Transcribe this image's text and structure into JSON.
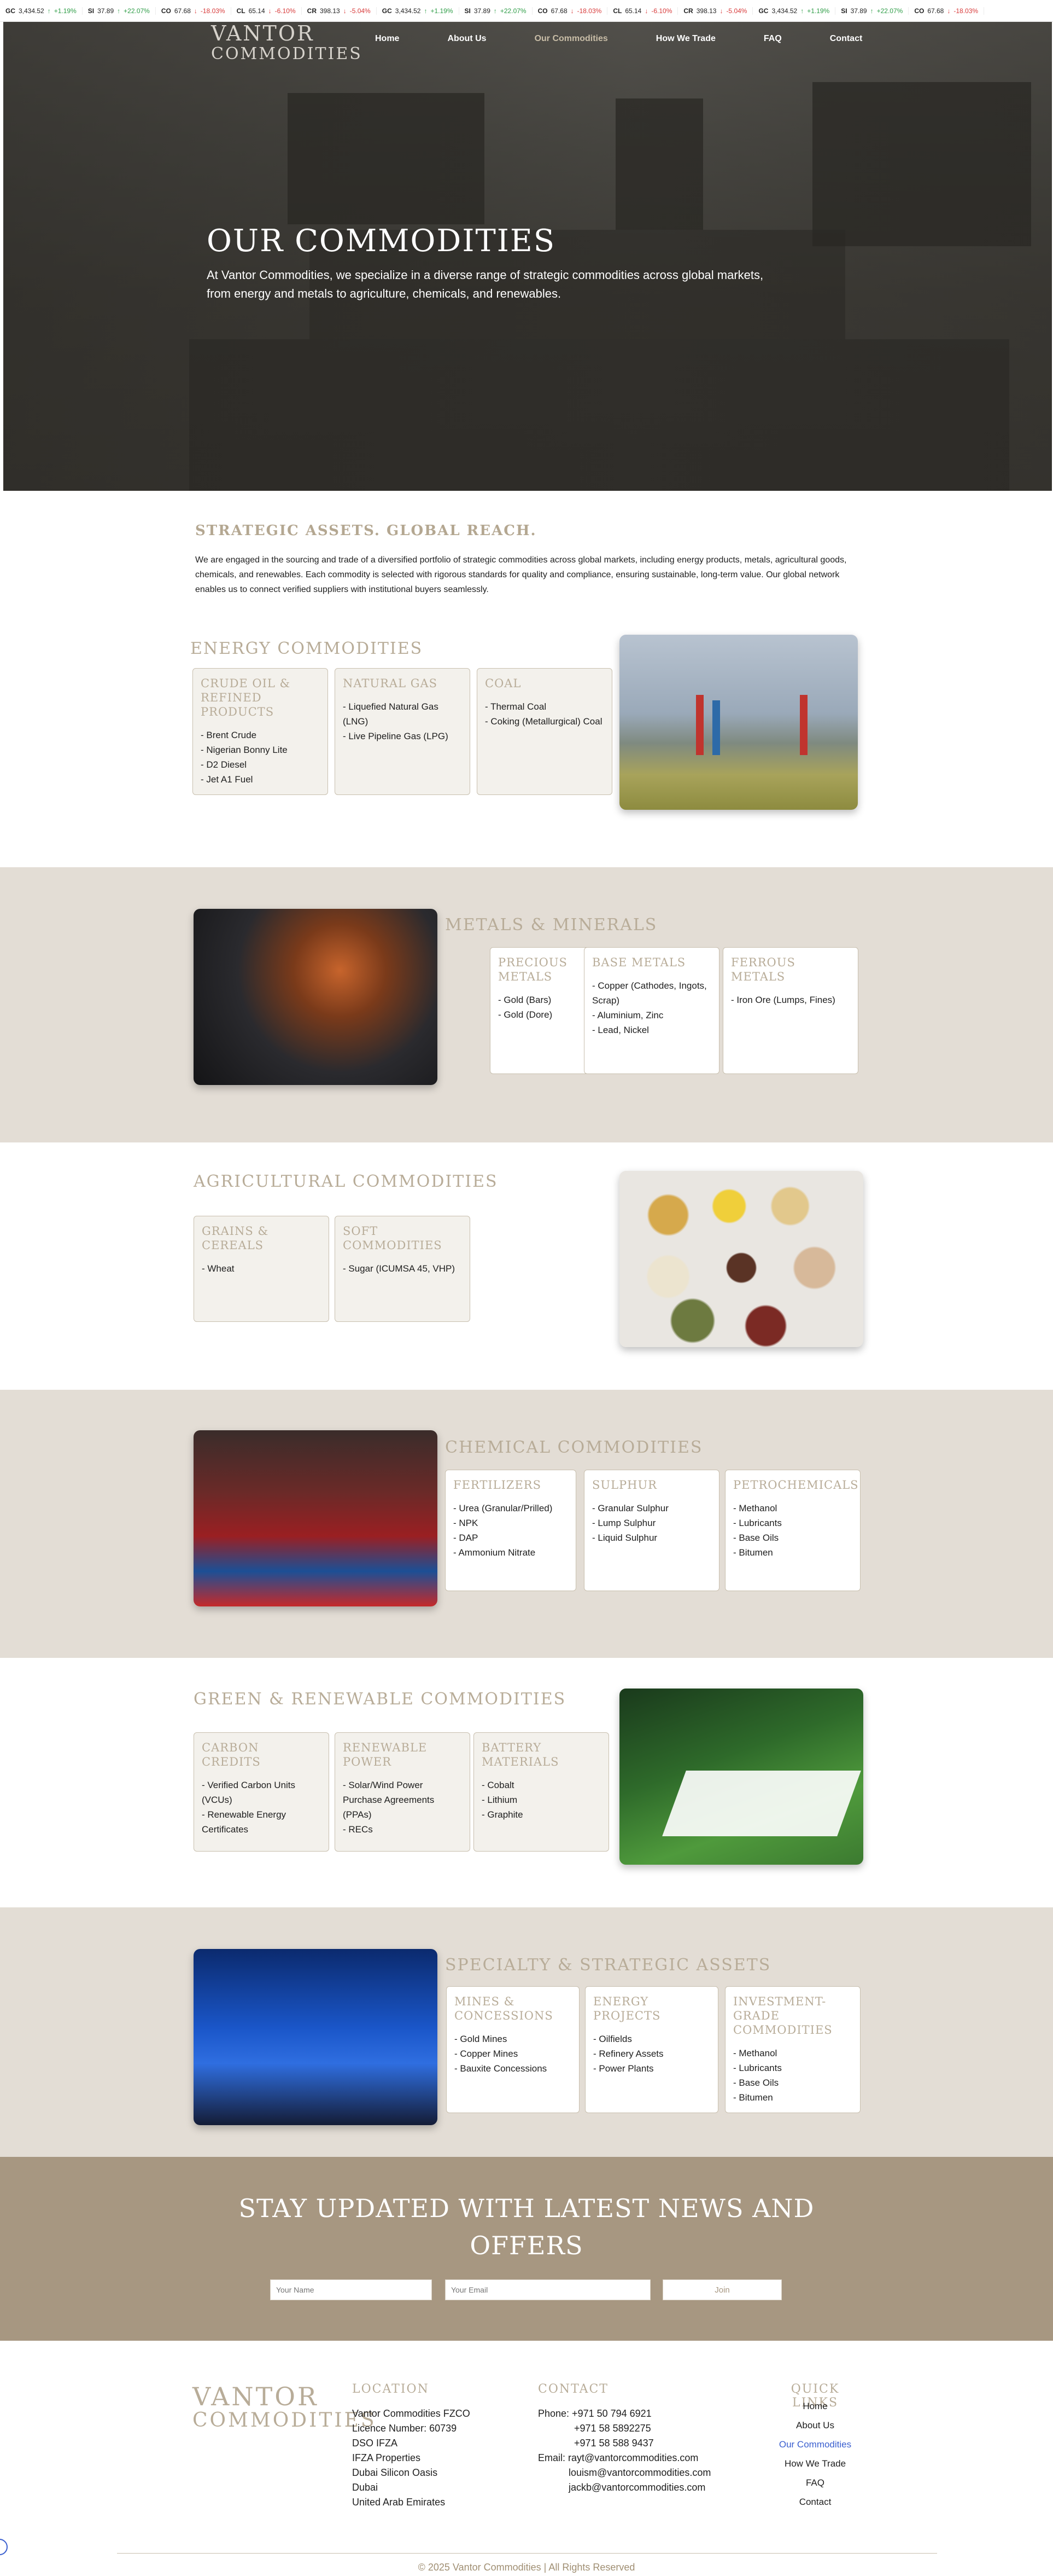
{
  "ticker": [
    {
      "sym": "GC",
      "price": "3,434.52",
      "dir": "up",
      "chg": "+1.19%"
    },
    {
      "sym": "SI",
      "price": "37.89",
      "dir": "up",
      "chg": "+22.07%"
    },
    {
      "sym": "CO",
      "price": "67.68",
      "dir": "down",
      "chg": "-18.03%"
    },
    {
      "sym": "CL",
      "price": "65.14",
      "dir": "down",
      "chg": "-6.10%"
    },
    {
      "sym": "CR",
      "price": "398.13",
      "dir": "down",
      "chg": "-5.04%"
    },
    {
      "sym": "GC",
      "price": "3,434.52",
      "dir": "up",
      "chg": "+1.19%"
    },
    {
      "sym": "SI",
      "price": "37.89",
      "dir": "up",
      "chg": "+22.07%"
    },
    {
      "sym": "CO",
      "price": "67.68",
      "dir": "down",
      "chg": "-18.03%"
    },
    {
      "sym": "CL",
      "price": "65.14",
      "dir": "down",
      "chg": "-6.10%"
    },
    {
      "sym": "CR",
      "price": "398.13",
      "dir": "down",
      "chg": "-5.04%"
    },
    {
      "sym": "GC",
      "price": "3,434.52",
      "dir": "up",
      "chg": "+1.19%"
    },
    {
      "sym": "SI",
      "price": "37.89",
      "dir": "up",
      "chg": "+22.07%"
    },
    {
      "sym": "CO",
      "price": "67.68",
      "dir": "down",
      "chg": "-18.03%"
    }
  ],
  "brand": {
    "line1": "VANTOR",
    "line2": "COMMODITIES"
  },
  "nav": [
    "Home",
    "About Us",
    "Our Commodities",
    "How We Trade",
    "FAQ",
    "Contact"
  ],
  "hero": {
    "title": "OUR COMMODITIES",
    "subtitle": "At Vantor Commodities, we specialize in a diverse range of strategic commodities across global markets, from energy and metals to agriculture, chemicals, and renewables."
  },
  "intro": {
    "title": "STRATEGIC ASSETS. GLOBAL REACH.",
    "text": "We are engaged in the sourcing and trade of a diversified portfolio of strategic commodities across global markets, including energy products, metals, agricultural goods, chemicals, and renewables. Each commodity is selected with rigorous standards for quality and compliance, ensuring sustainable, long-term value. Our global network enables us to connect verified suppliers with institutional buyers seamlessly."
  },
  "energy": {
    "title": "ENERGY COMMODITIES",
    "cards": [
      {
        "title": "CRUDE OIL & REFINED PRODUCTS",
        "items": [
          "Brent Crude",
          "Nigerian Bonny Lite",
          "D2 Diesel",
          "Jet A1 Fuel"
        ]
      },
      {
        "title": "NATURAL GAS",
        "items": [
          "Liquefied Natural Gas (LNG)",
          "Live Pipeline Gas (LPG)"
        ]
      },
      {
        "title": "COAL",
        "items": [
          "Thermal Coal",
          "Coking (Metallurgical) Coal"
        ]
      }
    ]
  },
  "metals": {
    "title": "METALS & MINERALS",
    "cards": [
      {
        "title": "PRECIOUS METALS",
        "items": [
          "Gold (Bars)",
          "Gold (Dore)"
        ]
      },
      {
        "title": "BASE METALS",
        "items": [
          "Copper (Cathodes, Ingots, Scrap)",
          "Aluminium, Zinc",
          "Lead, Nickel"
        ]
      },
      {
        "title": "FERROUS METALS",
        "items": [
          "Iron Ore (Lumps, Fines)"
        ]
      }
    ]
  },
  "agri": {
    "title": "AGRICULTURAL COMMODITIES",
    "cards": [
      {
        "title": "GRAINS & CEREALS",
        "items": [
          "Wheat"
        ]
      },
      {
        "title": "SOFT COMMODITIES",
        "items": [
          "Sugar (ICUMSA 45, VHP)"
        ]
      }
    ]
  },
  "chem": {
    "title": "CHEMICAL COMMODITIES",
    "cards": [
      {
        "title": "FERTILIZERS",
        "items": [
          "Urea (Granular/Prilled)",
          "NPK",
          "DAP",
          "Ammonium Nitrate"
        ]
      },
      {
        "title": "SULPHUR",
        "items": [
          "Granular Sulphur",
          "Lump Sulphur",
          "Liquid Sulphur"
        ]
      },
      {
        "title": "PETROCHEMICALS",
        "items": [
          "Methanol",
          "Lubricants",
          "Base Oils",
          "Bitumen"
        ]
      }
    ]
  },
  "green": {
    "title": "GREEN & RENEWABLE COMMODITIES",
    "cards": [
      {
        "title": "CARBON CREDITS",
        "items": [
          "Verified Carbon Units (VCUs)",
          "Renewable Energy Certificates"
        ]
      },
      {
        "title": "RENEWABLE POWER",
        "items": [
          "Solar/Wind Power Purchase Agreements (PPAs)",
          "RECs"
        ]
      },
      {
        "title": "BATTERY MATERIALS",
        "items": [
          "Cobalt",
          "Lithium",
          "Graphite"
        ]
      }
    ]
  },
  "special": {
    "title": "SPECIALTY & STRATEGIC ASSETS",
    "cards": [
      {
        "title": "MINES & CONCESSIONS",
        "items": [
          "Gold Mines",
          "Copper Mines",
          "Bauxite Concessions"
        ]
      },
      {
        "title": "ENERGY PROJECTS",
        "items": [
          "Oilfields",
          "Refinery Assets",
          "Power Plants"
        ]
      },
      {
        "title": "INVESTMENT-GRADE COMMODITIES",
        "items": [
          "Methanol",
          "Lubricants",
          "Base Oils",
          "Bitumen"
        ]
      }
    ]
  },
  "newsletter": {
    "title_line1": "STAY UPDATED WITH LATEST NEWS AND",
    "title_line2": "OFFERS",
    "name_placeholder": "Your Name",
    "email_placeholder": "Your Email",
    "join_label": "Join"
  },
  "footer": {
    "location_title": "LOCATION",
    "location": [
      "Vantor Commodities FZCO",
      "Licence Number: 60739",
      "DSO IFZA",
      "IFZA Properties",
      "Dubai Silicon Oasis",
      "Dubai",
      "United Arab Emirates"
    ],
    "contact_title": "CONTACT",
    "contact": [
      "Phone: +971 50 794 6921",
      "+971 58 5892275",
      "+971 58 588 9437",
      "Email: rayt@vantorcommodities.com",
      "louism@vantorcommodities.com",
      "jackb@vantorcommodities.com"
    ],
    "quick_title": "QUICK LINKS",
    "quick": [
      "Home",
      "About Us",
      "Our Commodities",
      "How We Trade",
      "FAQ",
      "Contact"
    ],
    "copyright": "© 2025 Vantor Commodities | All Rights Reserved"
  },
  "colors": {
    "accent": "#b8ac98",
    "beige": "#e3ddd5",
    "news": "#a79781",
    "up": "#2e9d47",
    "down": "#d83a3a"
  }
}
